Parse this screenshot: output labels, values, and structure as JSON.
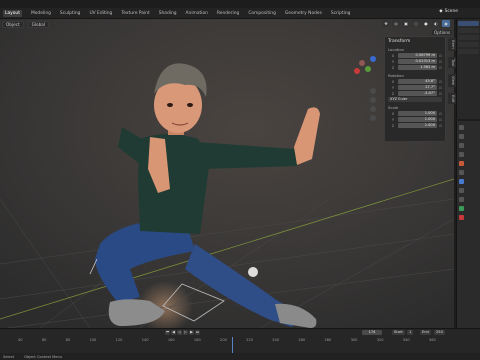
{
  "workspace_tabs": [
    "Layout",
    "Modeling",
    "Sculpting",
    "UV Editing",
    "Texture Paint",
    "Shading",
    "Animation",
    "Rendering",
    "Compositing",
    "Geometry Nodes",
    "Scripting"
  ],
  "active_tab_index": 0,
  "scene": {
    "label": "Scene"
  },
  "viewport_header": {
    "mode": "Object",
    "orientation": "Global",
    "options_label": "Options"
  },
  "npanel": {
    "section": "Transform",
    "location": {
      "label": "Location",
      "x": "0.56799 m",
      "y": "0.02313 m",
      "z": "1.562 m"
    },
    "rotation": {
      "label": "Rotation",
      "x": "45.8°",
      "y": "27.7°",
      "z": "-3.07°"
    },
    "rotation_mode": "XYZ Euler",
    "scale": {
      "label": "Scale",
      "x": "1.000",
      "y": "1.000",
      "z": "1.000"
    },
    "axes": [
      "X",
      "Y",
      "Z"
    ]
  },
  "side_tabs": [
    "Item",
    "Tool",
    "View",
    "Edit"
  ],
  "timeline": {
    "current_frame": "174",
    "start_label": "Start",
    "start_value": "1",
    "end_label": "End",
    "end_value": "250",
    "ruler": [
      "40",
      "60",
      "80",
      "100",
      "120",
      "140",
      "160",
      "180",
      "200",
      "220",
      "240",
      "260",
      "280",
      "300",
      "320",
      "340",
      "360"
    ]
  },
  "status": {
    "left": "Select",
    "middle": "Object Context Menu"
  },
  "colors": {
    "accent": "#5a82c8",
    "background": "#3a3a3a"
  }
}
